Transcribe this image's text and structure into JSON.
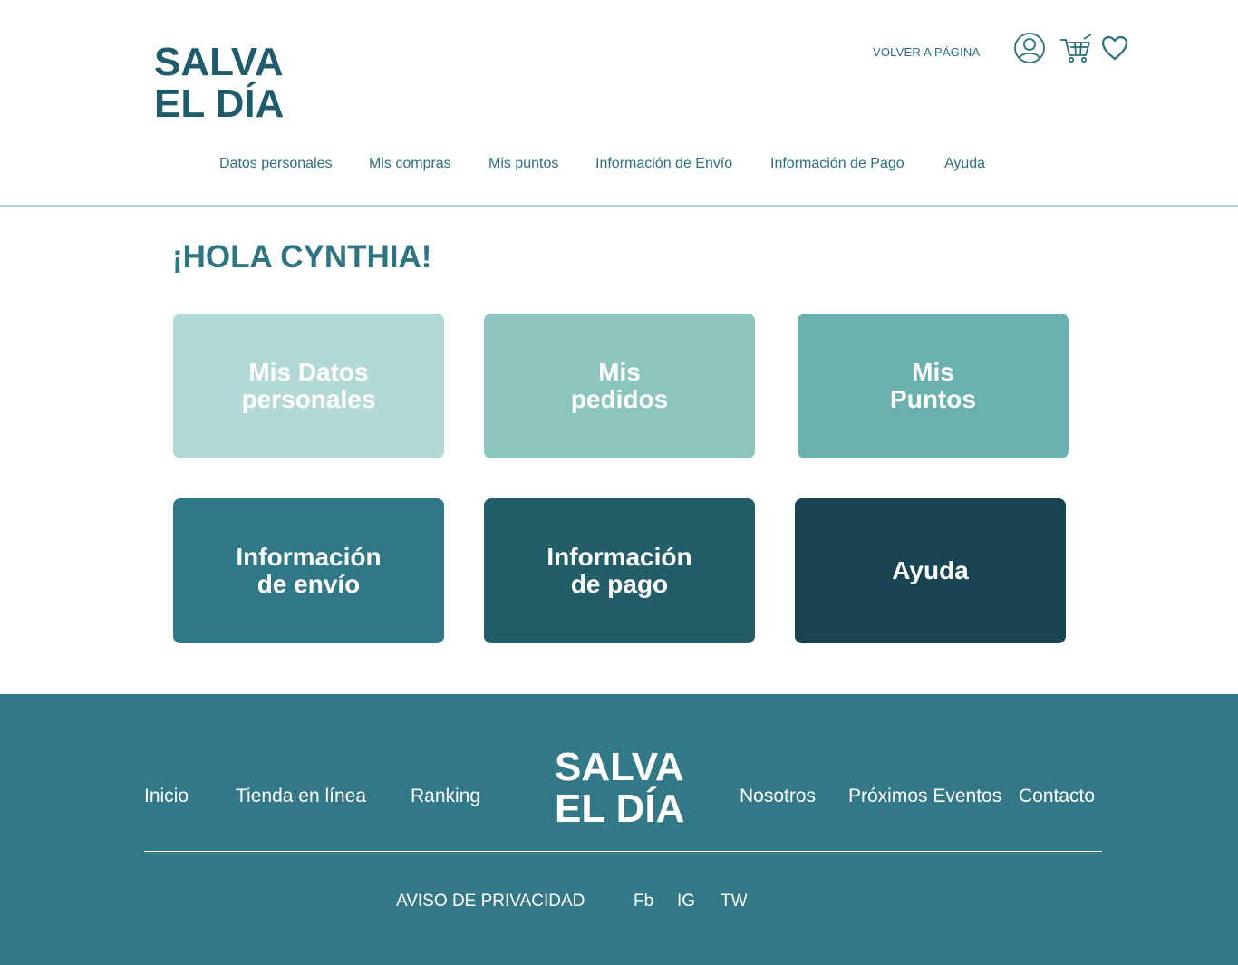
{
  "header": {
    "logo_line1": "SALVA",
    "logo_line2": "EL DÍA",
    "back_link": "VOLVER A PÁGINA",
    "icons": [
      "user-icon",
      "cart-icon",
      "heart-icon"
    ]
  },
  "nav": {
    "items": [
      {
        "label": "Datos personales"
      },
      {
        "label": "Mis compras"
      },
      {
        "label": "Mis puntos"
      },
      {
        "label": "Información de Envío"
      },
      {
        "label": "Información de Pago"
      },
      {
        "label": "Ayuda"
      }
    ]
  },
  "main": {
    "greeting": "¡HOLA CYNTHIA!",
    "cards": [
      {
        "line1": "Mis Datos",
        "line2": "personales",
        "color": "#b3d9d7"
      },
      {
        "line1": "Mis",
        "line2": "pedidos",
        "color": "#8cc5bd"
      },
      {
        "line1": "Mis",
        "line2": "Puntos",
        "color": "#6bb1b0"
      },
      {
        "line1": "Información",
        "line2": "de envío",
        "color": "#307787"
      },
      {
        "line1": "Información",
        "line2": "de pago",
        "color": "#235d6a"
      },
      {
        "line1": "Ayuda",
        "line2": "",
        "color": "#184351"
      }
    ]
  },
  "footer": {
    "links_left": [
      {
        "label": "Inicio"
      },
      {
        "label": "Tienda en línea"
      },
      {
        "label": "Ranking"
      }
    ],
    "logo_line1": "SALVA",
    "logo_line2": "EL DÍA",
    "links_right": [
      {
        "label": "Nosotros"
      },
      {
        "label": "Próximos Eventos"
      },
      {
        "label": "Contacto"
      }
    ],
    "privacy": "AVISO DE PRIVACIDAD",
    "social": [
      {
        "label": "Fb"
      },
      {
        "label": "IG"
      },
      {
        "label": "TW"
      }
    ],
    "background": "#337886"
  },
  "colors": {
    "accent": "#2a6f7c",
    "logo": "#1f5c6b"
  }
}
